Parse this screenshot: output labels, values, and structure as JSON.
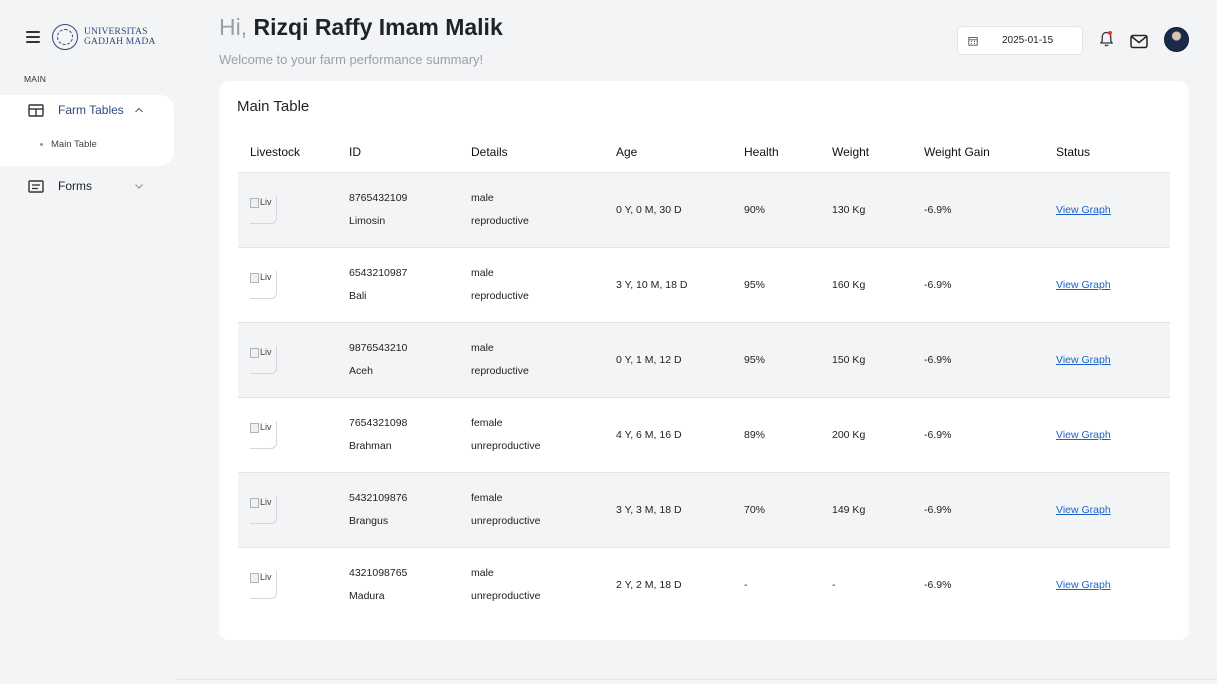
{
  "sidebar": {
    "logo_line1": "UNIVERSITAS",
    "logo_line2": "GADJAH MADA",
    "section_label": "MAIN",
    "items": [
      {
        "label": "Farm Tables",
        "icon": "table-icon",
        "expanded": true
      },
      {
        "label": "Forms",
        "icon": "form-icon",
        "expanded": false
      }
    ],
    "sub_items": [
      {
        "label": "Main Table"
      }
    ]
  },
  "header": {
    "greeting_prefix": "Hi,",
    "user_name": "Rizqi Raffy Imam Malik",
    "subtitle": "Welcome to your farm performance summary!",
    "date": "2025-01-15"
  },
  "colors": {
    "accent": "#2d4a7c",
    "link": "#1a62c9",
    "background": "#f3f4f6"
  },
  "table": {
    "title": "Main Table",
    "columns": [
      "Livestock",
      "ID",
      "Details",
      "Age",
      "Health",
      "Weight",
      "Weight Gain",
      "Status"
    ],
    "rows": [
      {
        "img_alt": "Liv",
        "id": "8765432109",
        "breed": "Limosin",
        "sex": "male",
        "repro": "reproductive",
        "age": "0 Y, 0 M, 30 D",
        "health": "90%",
        "weight": "130 Kg",
        "gain": "-6.9%",
        "status": "View Graph"
      },
      {
        "img_alt": "Liv",
        "id": "6543210987",
        "breed": "Bali",
        "sex": "male",
        "repro": "reproductive",
        "age": "3 Y, 10 M, 18 D",
        "health": "95%",
        "weight": "160 Kg",
        "gain": "-6.9%",
        "status": "View Graph"
      },
      {
        "img_alt": "Liv",
        "id": "9876543210",
        "breed": "Aceh",
        "sex": "male",
        "repro": "reproductive",
        "age": "0 Y, 1 M, 12 D",
        "health": "95%",
        "weight": "150 Kg",
        "gain": "-6.9%",
        "status": "View Graph"
      },
      {
        "img_alt": "Liv",
        "id": "7654321098",
        "breed": "Brahman",
        "sex": "female",
        "repro": "unreproductive",
        "age": "4 Y, 6 M, 16 D",
        "health": "89%",
        "weight": "200 Kg",
        "gain": "-6.9%",
        "status": "View Graph"
      },
      {
        "img_alt": "Liv",
        "id": "5432109876",
        "breed": "Brangus",
        "sex": "female",
        "repro": "unreproductive",
        "age": "3 Y, 3 M, 18 D",
        "health": "70%",
        "weight": "149 Kg",
        "gain": "-6.9%",
        "status": "View Graph"
      },
      {
        "img_alt": "Liv",
        "id": "4321098765",
        "breed": "Madura",
        "sex": "male",
        "repro": "unreproductive",
        "age": "2 Y, 2 M, 18 D",
        "health": "-",
        "weight": "-",
        "gain": "-6.9%",
        "status": "View Graph"
      }
    ]
  }
}
